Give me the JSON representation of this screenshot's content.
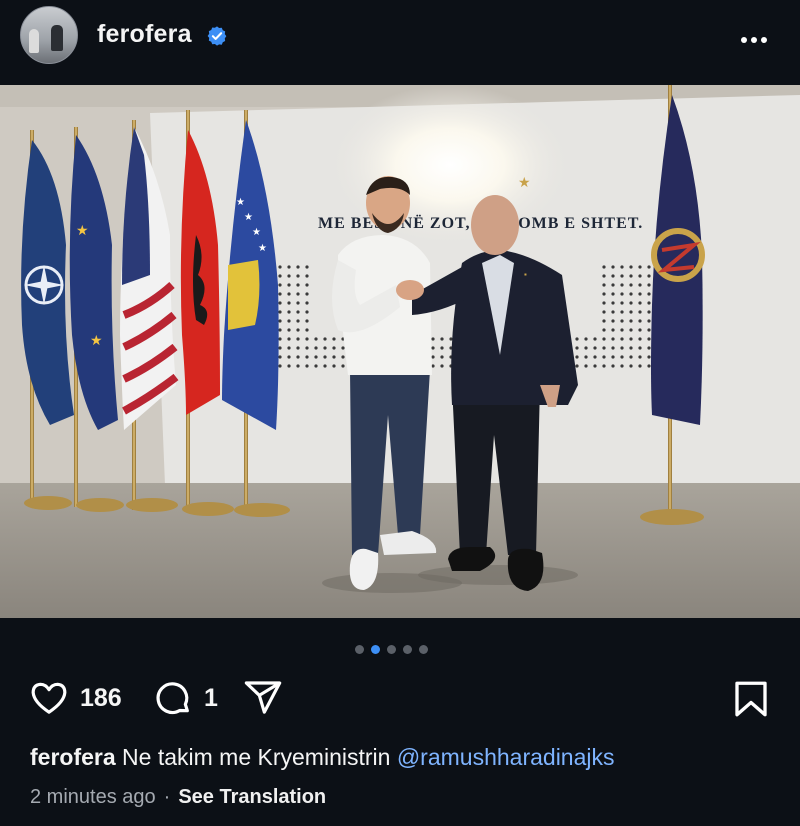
{
  "post": {
    "username": "ferofera",
    "verified": true,
    "more_icon": "more-horizontal-icon"
  },
  "photo": {
    "wall_text_line1": "ME BESË NË ZOT, NË KOMB E SHTET.",
    "flags": [
      "NATO",
      "EU",
      "USA",
      "Albania",
      "Kosovo",
      "Party"
    ]
  },
  "carousel": {
    "total": 5,
    "active_index": 1
  },
  "actions": {
    "likes": "186",
    "comments": "1",
    "icons": [
      "heart-icon",
      "comment-icon",
      "share-icon",
      "bookmark-icon"
    ]
  },
  "caption": {
    "username": "ferofera",
    "text": "Ne takim me Kryeministrin",
    "mention": "@ramushharadinajks"
  },
  "meta": {
    "time": "2 minutes ago",
    "separator": "·",
    "translate": "See Translation"
  },
  "colors": {
    "background": "#0c1016",
    "verified": "#3d8ff5",
    "mention": "#7fb4ff",
    "active_dot": "#3d8ff5"
  }
}
